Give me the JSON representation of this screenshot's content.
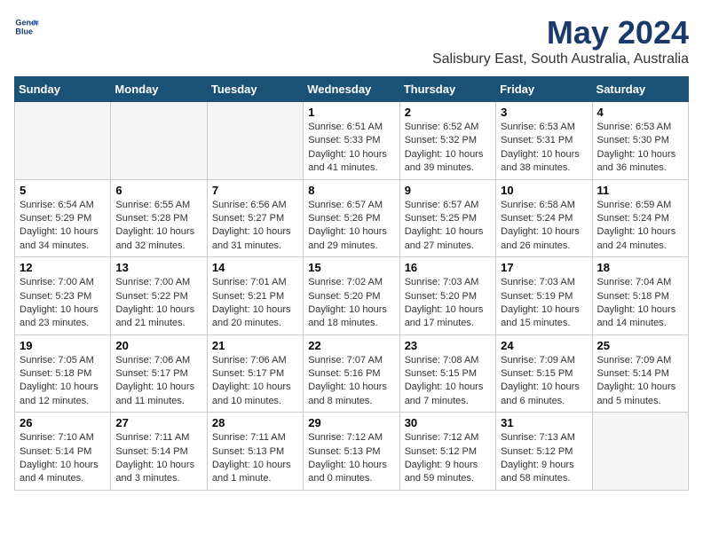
{
  "header": {
    "logo_line1": "General",
    "logo_line2": "Blue",
    "month": "May 2024",
    "location": "Salisbury East, South Australia, Australia"
  },
  "weekdays": [
    "Sunday",
    "Monday",
    "Tuesday",
    "Wednesday",
    "Thursday",
    "Friday",
    "Saturday"
  ],
  "weeks": [
    [
      {
        "day": "",
        "info": ""
      },
      {
        "day": "",
        "info": ""
      },
      {
        "day": "",
        "info": ""
      },
      {
        "day": "1",
        "info": "Sunrise: 6:51 AM\nSunset: 5:33 PM\nDaylight: 10 hours\nand 41 minutes."
      },
      {
        "day": "2",
        "info": "Sunrise: 6:52 AM\nSunset: 5:32 PM\nDaylight: 10 hours\nand 39 minutes."
      },
      {
        "day": "3",
        "info": "Sunrise: 6:53 AM\nSunset: 5:31 PM\nDaylight: 10 hours\nand 38 minutes."
      },
      {
        "day": "4",
        "info": "Sunrise: 6:53 AM\nSunset: 5:30 PM\nDaylight: 10 hours\nand 36 minutes."
      }
    ],
    [
      {
        "day": "5",
        "info": "Sunrise: 6:54 AM\nSunset: 5:29 PM\nDaylight: 10 hours\nand 34 minutes."
      },
      {
        "day": "6",
        "info": "Sunrise: 6:55 AM\nSunset: 5:28 PM\nDaylight: 10 hours\nand 32 minutes."
      },
      {
        "day": "7",
        "info": "Sunrise: 6:56 AM\nSunset: 5:27 PM\nDaylight: 10 hours\nand 31 minutes."
      },
      {
        "day": "8",
        "info": "Sunrise: 6:57 AM\nSunset: 5:26 PM\nDaylight: 10 hours\nand 29 minutes."
      },
      {
        "day": "9",
        "info": "Sunrise: 6:57 AM\nSunset: 5:25 PM\nDaylight: 10 hours\nand 27 minutes."
      },
      {
        "day": "10",
        "info": "Sunrise: 6:58 AM\nSunset: 5:24 PM\nDaylight: 10 hours\nand 26 minutes."
      },
      {
        "day": "11",
        "info": "Sunrise: 6:59 AM\nSunset: 5:24 PM\nDaylight: 10 hours\nand 24 minutes."
      }
    ],
    [
      {
        "day": "12",
        "info": "Sunrise: 7:00 AM\nSunset: 5:23 PM\nDaylight: 10 hours\nand 23 minutes."
      },
      {
        "day": "13",
        "info": "Sunrise: 7:00 AM\nSunset: 5:22 PM\nDaylight: 10 hours\nand 21 minutes."
      },
      {
        "day": "14",
        "info": "Sunrise: 7:01 AM\nSunset: 5:21 PM\nDaylight: 10 hours\nand 20 minutes."
      },
      {
        "day": "15",
        "info": "Sunrise: 7:02 AM\nSunset: 5:20 PM\nDaylight: 10 hours\nand 18 minutes."
      },
      {
        "day": "16",
        "info": "Sunrise: 7:03 AM\nSunset: 5:20 PM\nDaylight: 10 hours\nand 17 minutes."
      },
      {
        "day": "17",
        "info": "Sunrise: 7:03 AM\nSunset: 5:19 PM\nDaylight: 10 hours\nand 15 minutes."
      },
      {
        "day": "18",
        "info": "Sunrise: 7:04 AM\nSunset: 5:18 PM\nDaylight: 10 hours\nand 14 minutes."
      }
    ],
    [
      {
        "day": "19",
        "info": "Sunrise: 7:05 AM\nSunset: 5:18 PM\nDaylight: 10 hours\nand 12 minutes."
      },
      {
        "day": "20",
        "info": "Sunrise: 7:06 AM\nSunset: 5:17 PM\nDaylight: 10 hours\nand 11 minutes."
      },
      {
        "day": "21",
        "info": "Sunrise: 7:06 AM\nSunset: 5:17 PM\nDaylight: 10 hours\nand 10 minutes."
      },
      {
        "day": "22",
        "info": "Sunrise: 7:07 AM\nSunset: 5:16 PM\nDaylight: 10 hours\nand 8 minutes."
      },
      {
        "day": "23",
        "info": "Sunrise: 7:08 AM\nSunset: 5:15 PM\nDaylight: 10 hours\nand 7 minutes."
      },
      {
        "day": "24",
        "info": "Sunrise: 7:09 AM\nSunset: 5:15 PM\nDaylight: 10 hours\nand 6 minutes."
      },
      {
        "day": "25",
        "info": "Sunrise: 7:09 AM\nSunset: 5:14 PM\nDaylight: 10 hours\nand 5 minutes."
      }
    ],
    [
      {
        "day": "26",
        "info": "Sunrise: 7:10 AM\nSunset: 5:14 PM\nDaylight: 10 hours\nand 4 minutes."
      },
      {
        "day": "27",
        "info": "Sunrise: 7:11 AM\nSunset: 5:14 PM\nDaylight: 10 hours\nand 3 minutes."
      },
      {
        "day": "28",
        "info": "Sunrise: 7:11 AM\nSunset: 5:13 PM\nDaylight: 10 hours\nand 1 minute."
      },
      {
        "day": "29",
        "info": "Sunrise: 7:12 AM\nSunset: 5:13 PM\nDaylight: 10 hours\nand 0 minutes."
      },
      {
        "day": "30",
        "info": "Sunrise: 7:12 AM\nSunset: 5:12 PM\nDaylight: 9 hours\nand 59 minutes."
      },
      {
        "day": "31",
        "info": "Sunrise: 7:13 AM\nSunset: 5:12 PM\nDaylight: 9 hours\nand 58 minutes."
      },
      {
        "day": "",
        "info": ""
      }
    ]
  ]
}
